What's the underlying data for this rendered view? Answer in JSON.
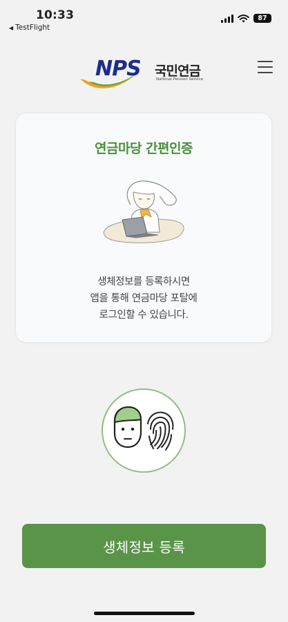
{
  "status_bar": {
    "time": "10:33",
    "back_app": "TestFlight",
    "battery": "87"
  },
  "header": {
    "logo_text": "NPS",
    "logo_korean": "국민연금",
    "logo_english": "National Pension Service"
  },
  "card": {
    "title": "연금마당 간편인증",
    "desc_line1": "생체정보를 등록하시면",
    "desc_line2": "앱을 통해 연금마당 포탈에",
    "desc_line3": "로그인할 수 있습니다."
  },
  "actions": {
    "register_label": "생체정보 등록"
  },
  "colors": {
    "accent_green": "#5a9448",
    "title_green": "#4a8f3a",
    "logo_blue": "#1c2c8c"
  }
}
